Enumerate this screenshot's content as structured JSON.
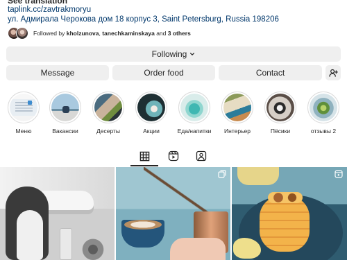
{
  "bio": {
    "see_translation": "See translation",
    "link": "taplink.cc/zavtrakmoryu",
    "address": "ул. Адмирала Черокова дом 18 корпус 3, Saint Petersburg, Russia 198206"
  },
  "followed_by": {
    "prefix": "Followed by ",
    "user1": "kholzunova",
    "separator": ", ",
    "user2": "tanechkaminskaya",
    "connector": " and ",
    "others": "3 others"
  },
  "buttons": {
    "following": "Following",
    "message": "Message",
    "order_food": "Order food",
    "contact": "Contact"
  },
  "highlights": [
    {
      "label": "Меню"
    },
    {
      "label": "Вакансии"
    },
    {
      "label": "Десерты"
    },
    {
      "label": "Акции"
    },
    {
      "label": "Еда/напитки"
    },
    {
      "label": "Интерьер"
    },
    {
      "label": "Пёсики"
    },
    {
      "label": "отзывы 2"
    }
  ],
  "tabs": {
    "active": "posts",
    "icons": [
      "grid-icon",
      "reels-icon",
      "tagged-icon"
    ]
  },
  "colors": {
    "link": "#00376b",
    "button_bg": "#efefef",
    "text": "#262626"
  }
}
